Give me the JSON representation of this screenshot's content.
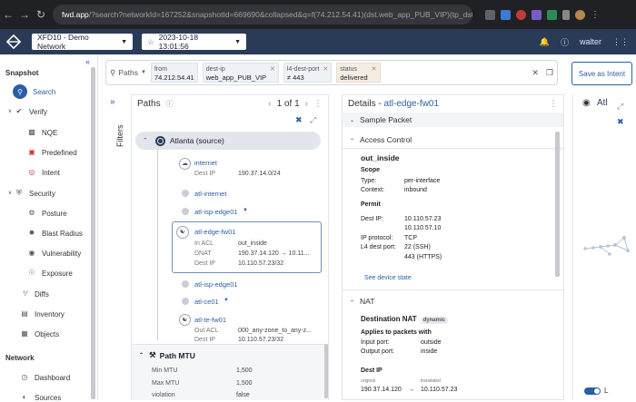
{
  "browser": {
    "url_domain": "fwd.app",
    "url_rest": "/?search?networkId=167252&snapshotId=669690&collapsed&q=f(74.212.54.41)(dst.web_app_PUB_VIP)(tp_dst...",
    "profile": "walter"
  },
  "header": {
    "network": "XFD10 - Demo Network",
    "snapshot_date": "2023-10-18 13:01:56",
    "user": "walter"
  },
  "sidebar": {
    "snapshot_heading": "Snapshot",
    "items_snapshot": [
      {
        "label": "Search",
        "icon": "search-icon",
        "active": true
      },
      {
        "label": "Verify",
        "icon": "check-circle-icon"
      },
      {
        "label": "NQE",
        "icon": "nqe-icon"
      },
      {
        "label": "Predefined",
        "icon": "predefined-icon"
      },
      {
        "label": "Intent",
        "icon": "intent-icon"
      },
      {
        "label": "Security",
        "icon": "shield-icon"
      },
      {
        "label": "Posture",
        "icon": "posture-icon"
      },
      {
        "label": "Blast Radius",
        "icon": "blast-icon"
      },
      {
        "label": "Vulnerability",
        "icon": "bug-icon"
      },
      {
        "label": "Exposure",
        "icon": "exposure-icon"
      },
      {
        "label": "Diffs",
        "icon": "diff-icon"
      },
      {
        "label": "Inventory",
        "icon": "inventory-icon"
      },
      {
        "label": "Objects",
        "icon": "objects-icon"
      }
    ],
    "network_heading": "Network",
    "items_network": [
      {
        "label": "Dashboard",
        "icon": "dashboard-icon"
      },
      {
        "label": "Sources",
        "icon": "sources-icon"
      }
    ]
  },
  "search": {
    "mode": "Paths",
    "chips": [
      {
        "key": "from",
        "value": "74.212.54.41"
      },
      {
        "key": "dest-ip",
        "value": "web_app_PUB_VIP"
      },
      {
        "key": "l4-dest-port",
        "value": "≠ 443"
      },
      {
        "key": "status",
        "value": "delivered"
      }
    ],
    "save_label": "Save as Intent"
  },
  "filters_label": "Filters",
  "paths": {
    "title": "Paths",
    "pager": "1 of 1",
    "source_label": "Atlanta (source)",
    "hops": [
      {
        "name": "internet",
        "rows": [
          [
            "Dest IP",
            "190.37.14.0/24"
          ]
        ]
      },
      {
        "name": "atl-internet",
        "rows": []
      },
      {
        "name": "atl-isp-edge01",
        "rows": []
      },
      {
        "name": "atl-edge-fw01",
        "rows": [
          [
            "In ACL",
            "out_inside"
          ],
          [
            "DNAT",
            "190.37.14.120 → 10.11..."
          ],
          [
            "Dest IP",
            "10.110.57.23/32"
          ]
        ]
      },
      {
        "name": "atl-isp-edge01",
        "rows": []
      },
      {
        "name": "atl-ce01",
        "rows": []
      },
      {
        "name": "atl-te-fw01",
        "rows": [
          [
            "Out ACL",
            "000_any-zone_to_any-z..."
          ],
          [
            "Dest IP",
            "10.110.57.23/32"
          ]
        ]
      }
    ],
    "mtu_title": "Path MTU",
    "mtu_rows": [
      [
        "Min MTU",
        "1,500"
      ],
      [
        "Max MTU",
        "1,500"
      ],
      [
        "violation",
        "false"
      ]
    ]
  },
  "details": {
    "title_prefix": "Details - ",
    "title_device": "atl-edge-fw01",
    "sample_packet": "Sample Packet",
    "access_control": "Access Control",
    "acl_name": "out_inside",
    "scope_heading": "Scope",
    "scope": [
      [
        "Type:",
        "per-interface"
      ],
      [
        "Context:",
        "inbound"
      ]
    ],
    "permit_heading": "Permit",
    "permit": [
      [
        "Dest IP:",
        "10.110.57.23"
      ],
      [
        "",
        "10.110.57.10"
      ],
      [
        "IP protocol:",
        "TCP"
      ],
      [
        "L4 dest port:",
        "22 (SSH)"
      ],
      [
        "",
        "443 (HTTPS)"
      ]
    ],
    "see_device_state": "See device state",
    "nat": "NAT",
    "dest_nat": "Destination NAT",
    "dest_nat_tag": "dynamic",
    "applies_heading": "Applies to packets with",
    "applies": [
      [
        "Input port:",
        "outside"
      ],
      [
        "Output port:",
        "inside"
      ]
    ],
    "destip_heading": "Dest IP",
    "original_label": "original",
    "translated_label": "translated",
    "original_ip": "190.37.14.120",
    "translated_ip": "10.110.57.23"
  },
  "map": {
    "title": "Atl",
    "toggle_label": "L"
  }
}
